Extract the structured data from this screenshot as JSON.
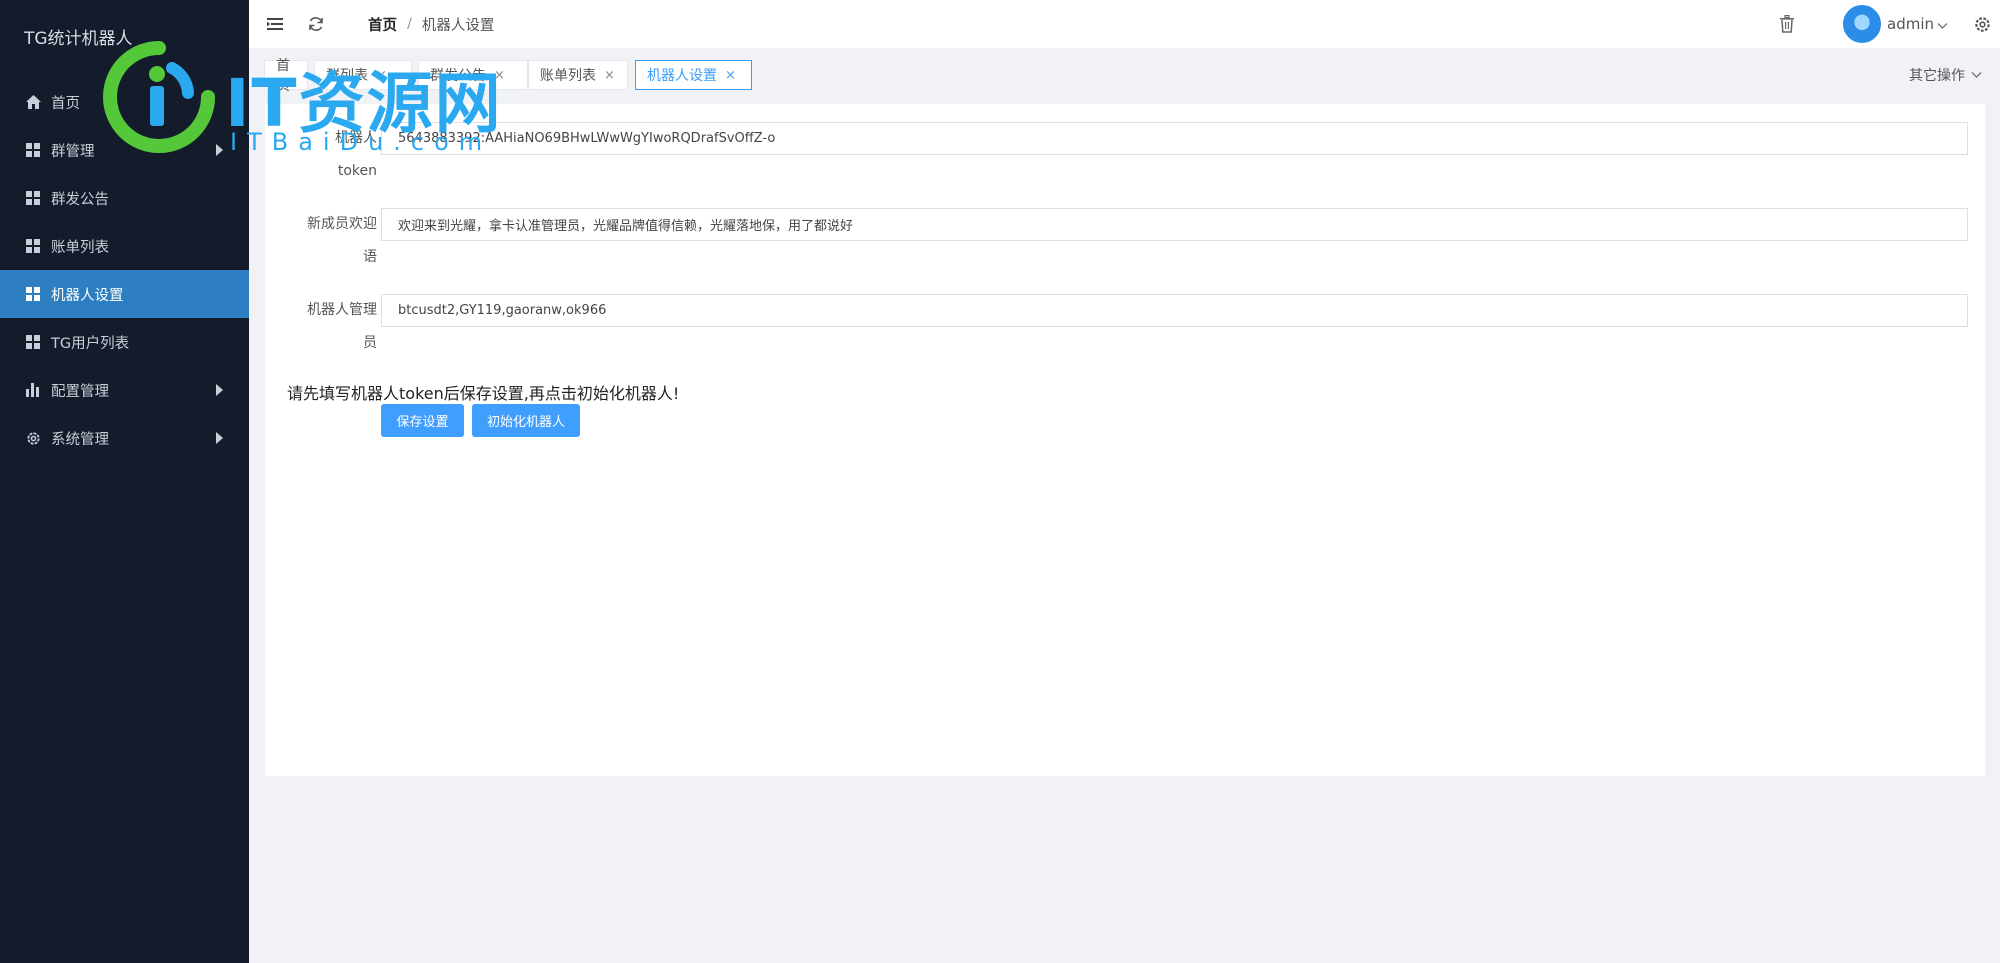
{
  "sidebar": {
    "brand": "TG统计机器人",
    "items": [
      {
        "label": "首页",
        "icon": "home-icon",
        "has_arrow": false,
        "active": false
      },
      {
        "label": "群管理",
        "icon": "grid-icon",
        "has_arrow": true,
        "active": false
      },
      {
        "label": "群发公告",
        "icon": "grid-icon",
        "has_arrow": false,
        "active": false
      },
      {
        "label": "账单列表",
        "icon": "grid-icon",
        "has_arrow": false,
        "active": false
      },
      {
        "label": "机器人设置",
        "icon": "grid-icon",
        "has_arrow": false,
        "active": true
      },
      {
        "label": "TG用户列表",
        "icon": "grid-icon",
        "has_arrow": false,
        "active": false
      },
      {
        "label": "配置管理",
        "icon": "bar-chart-icon",
        "has_arrow": true,
        "active": false
      },
      {
        "label": "系统管理",
        "icon": "gear-icon",
        "has_arrow": true,
        "active": false
      }
    ]
  },
  "header": {
    "breadcrumb_home": "首页",
    "breadcrumb_sep": "/",
    "breadcrumb_current": "机器人设置",
    "username": "admin"
  },
  "tabs": {
    "items": [
      {
        "label": "首页",
        "closable": false,
        "active": false
      },
      {
        "label": "群列表",
        "closable": true,
        "active": false
      },
      {
        "label": "群发公告",
        "closable": true,
        "active": false
      },
      {
        "label": "账单列表",
        "closable": true,
        "active": false
      },
      {
        "label": "机器人设置",
        "closable": true,
        "active": true
      }
    ],
    "close_glyph": "×",
    "other_ops": "其它操作"
  },
  "form": {
    "token_label_1": "机器人",
    "token_label_2": "token",
    "token_value": "5643883392:AAHiaNO69BHwLWwWgYIwoRQDrafSvOffZ-o",
    "welcome_label_1": "新成员欢迎",
    "welcome_label_2": "语",
    "welcome_value": "欢迎来到光耀，拿卡认准管理员，光耀品牌值得信赖，光耀落地保，用了都说好",
    "admin_label_1": "机器人管理",
    "admin_label_2": "员",
    "admin_value": "btcusdt2,GY119,gaoranw,ok966",
    "hint": "请先填写机器人token后保存设置,再点击初始化机器人!",
    "save_button": "保存设置",
    "init_button": "初始化机器人"
  },
  "watermark": {
    "text": "IT资源网",
    "sub": "ITBaiDu.com"
  },
  "colors": {
    "sidebar_bg": "#141c2c",
    "active_item": "#2d7fc1",
    "primary": "#409eff"
  }
}
